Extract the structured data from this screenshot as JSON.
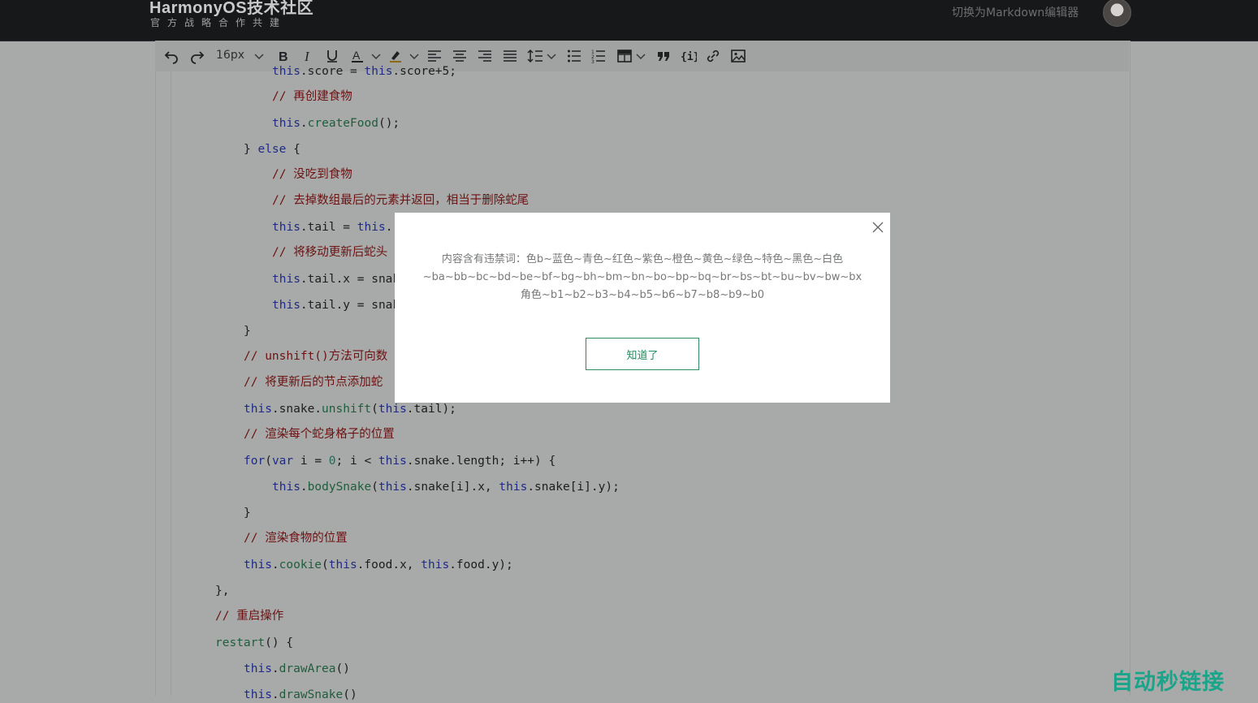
{
  "header": {
    "brand_title": "HarmonyOS技术社区",
    "brand_subtitle": "官方战略合作共建",
    "switch_editor": "切换为Markdown编辑器"
  },
  "toolbar": {
    "font_size": "16px",
    "icons": [
      "undo-icon",
      "redo-icon",
      "bold-icon",
      "italic-icon",
      "underline-icon",
      "font-color-icon",
      "highlight-icon",
      "align-left-icon",
      "align-center-icon",
      "align-right-icon",
      "align-justify-icon",
      "line-height-icon",
      "bullet-list-icon",
      "numbered-list-icon",
      "table-icon",
      "quote-icon",
      "code-block-icon",
      "link-icon",
      "image-icon"
    ]
  },
  "code": {
    "lines": [
      {
        "t": "this.score = this.score+5;"
      },
      {
        "t": "// 再创建食物"
      },
      {
        "t": "this.createFood();"
      },
      {
        "t": "} else {"
      },
      {
        "t": "// 没吃到食物"
      },
      {
        "t": "// 去掉数组最后的元素并返回，相当于删除蛇尾"
      },
      {
        "t": "this.tail = this."
      },
      {
        "t": "// 将移动更新后蛇头"
      },
      {
        "t": "this.tail.x = snak"
      },
      {
        "t": "this.tail.y = snak"
      },
      {
        "t": "}"
      },
      {
        "t": "// unshift()方法可向数"
      },
      {
        "t": "// 将更新后的节点添加蛇"
      },
      {
        "t": "this.snake.unshift(this.tail);"
      },
      {
        "t": "// 渲染每个蛇身格子的位置"
      },
      {
        "t": "for(var i = 0; i < this.snake.length; i++) {"
      },
      {
        "t": "this.bodySnake(this.snake[i].x, this.snake[i].y);"
      },
      {
        "t": "}"
      },
      {
        "t": "// 渲染食物的位置"
      },
      {
        "t": "this.cookie(this.food.x, this.food.y);"
      },
      {
        "t": "},"
      },
      {
        "t": "// 重启操作"
      },
      {
        "t": "restart() {"
      },
      {
        "t": "this.drawArea()"
      },
      {
        "t": "this.drawSnake()"
      }
    ]
  },
  "dialog": {
    "message_line1": "内容含有违禁词：色b~蓝色~青色~红色~紫色~橙色~黄色~绿色~特色~黑色~白色",
    "message_line2": "~ba~bb~bc~bd~be~bf~bg~bh~bm~bn~bo~bp~bq~br~bs~bt~bu~bv~bw~bx",
    "message_line3": "角色~b1~b2~b3~b4~b5~b6~b7~b8~b9~b0",
    "confirm_label": "知道了"
  },
  "watermark": "自动秒链接",
  "colors": {
    "dialog_button": "#1f8a5e",
    "watermark": "#1aa58a"
  }
}
